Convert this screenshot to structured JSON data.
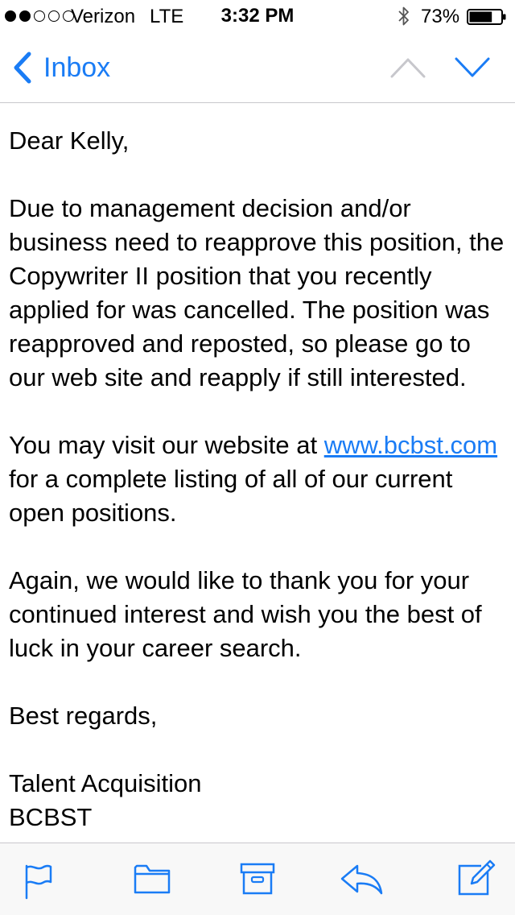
{
  "status_bar": {
    "carrier": "Verizon",
    "network": "LTE",
    "time": "3:32 PM",
    "battery_percent": "73%",
    "battery_level": 0.73,
    "signal_bars_filled": 2,
    "signal_bars_total": 5
  },
  "nav": {
    "back_label": "Inbox",
    "up_icon": "chevron-up-icon",
    "down_icon": "chevron-down-icon"
  },
  "email": {
    "greeting": "Dear Kelly,",
    "para1": "Due to management decision and/or business need to reapprove this position, the Copywriter II position that you recently applied for was cancelled.  The position was reapproved and reposted, so please go to our web site and reapply if still interested.",
    "para2_before": "You may visit our website at ",
    "para2_link": "www.bcbst.com",
    "para2_after": " for a complete listing of all of our current open positions.",
    "para3": "Again, we would like to thank you for your continued interest and wish you the best of luck in your career search.",
    "closing": "Best regards,",
    "signature_line1": "Talent Acquisition",
    "signature_line2": "BCBST"
  },
  "toolbar": {
    "items": [
      "flag-icon",
      "folder-icon",
      "archive-icon",
      "reply-icon",
      "compose-icon"
    ]
  },
  "colors": {
    "accent": "#1a7cf5",
    "disabled": "#c7c7cc",
    "separator": "#c8c7cc"
  }
}
